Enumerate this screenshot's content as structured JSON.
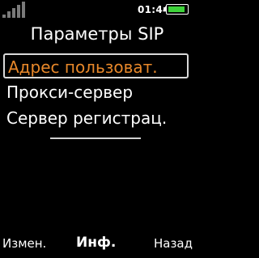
{
  "status_bar": {
    "time": "01:44",
    "signal_icon": "signal-strength-icon",
    "signal_bars_lit": 0,
    "battery_icon": "battery-icon",
    "battery_level": 0.85,
    "battery_color": "#3ed23a"
  },
  "title": "Параметры SIP",
  "menu": {
    "items": [
      {
        "label": "Адрес пользоват.",
        "selected": true
      },
      {
        "label": "Прокси-сервер",
        "selected": false
      },
      {
        "label": "Сервер регистрац.",
        "selected": false
      }
    ],
    "selected_color": "#e8882a"
  },
  "softkeys": {
    "left": "Измен.",
    "center": "Инф.",
    "right": "Назад"
  }
}
